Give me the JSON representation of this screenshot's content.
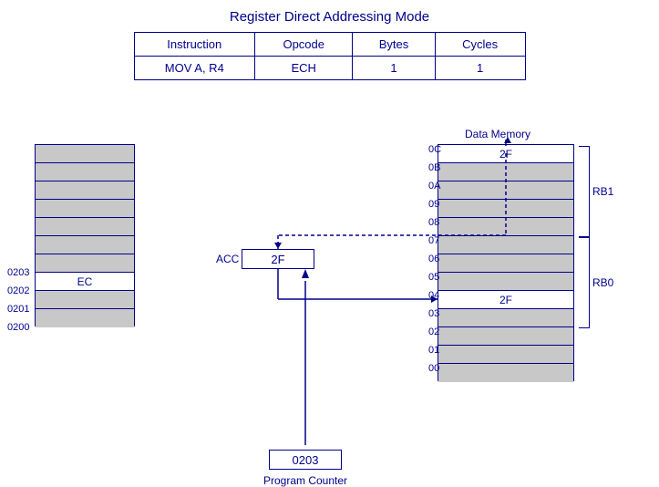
{
  "title": "Register Direct Addressing Mode",
  "table": {
    "headers": [
      "Instruction",
      "Opcode",
      "Bytes",
      "Cycles"
    ],
    "row": [
      "MOV A, R4",
      "ECH",
      "1",
      "1"
    ]
  },
  "diagram": {
    "acc_label": "ACC",
    "acc_value": "2F",
    "pc_value": "0203",
    "pc_label": "Program Counter",
    "data_memory_title": "Data Memory",
    "prog_mem_labels": [
      "0203",
      "0202",
      "0201",
      "0200"
    ],
    "prog_mem_ec_row": "EC",
    "data_mem_addrs": [
      "0C",
      "0B",
      "0A",
      "09",
      "08",
      "07",
      "06",
      "05",
      "04",
      "03",
      "02",
      "01",
      "00"
    ],
    "data_mem_values": {
      "0C": "2F",
      "04": "2F"
    },
    "rb1_label": "RB1",
    "rb0_label": "RB0"
  }
}
